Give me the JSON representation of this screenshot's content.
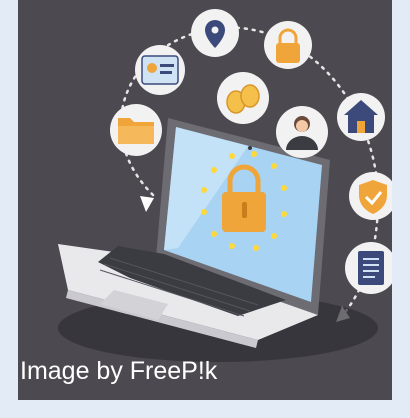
{
  "credit": {
    "text": "Image by FreeP!k"
  },
  "colors": {
    "background": "#4c4a50",
    "frame": "#e3ebf6",
    "icon_circle": "#f2f2f2",
    "accent_orange": "#f0a53a",
    "screen_blue": "#a8d3f2",
    "eu_star": "#ffd83a",
    "laptop_body": "#e9e9ec",
    "keyboard": "#3b3b42"
  },
  "icons": [
    "location-pin-icon",
    "padlock-icon",
    "id-card-icon",
    "coins-icon",
    "house-icon",
    "user-avatar-icon",
    "folder-icon",
    "shield-check-icon",
    "document-icon",
    "laptop-icon"
  ]
}
